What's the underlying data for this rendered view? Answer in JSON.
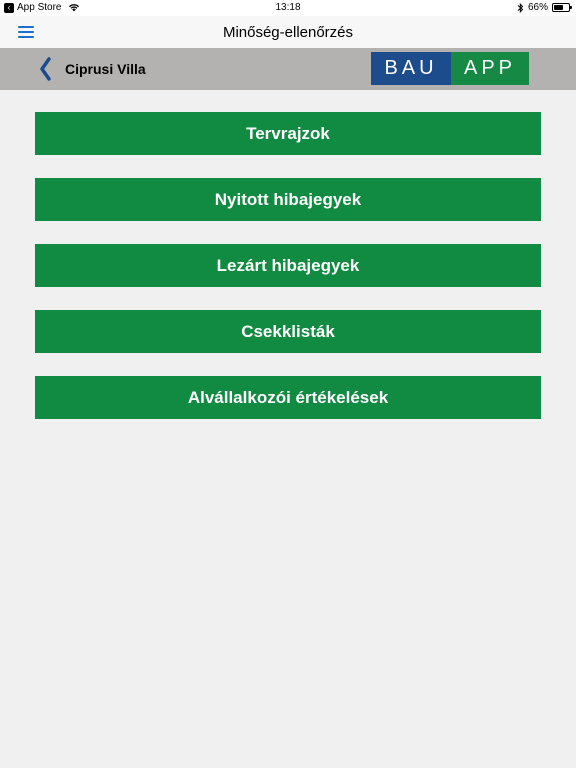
{
  "status_bar": {
    "back_app": "App Store",
    "time": "13:18",
    "battery": "66%",
    "battery_level": 0.66
  },
  "nav": {
    "title": "Minőség-ellenőrzés"
  },
  "project": {
    "title": "Ciprusi Villa"
  },
  "logo": {
    "part1": "BAU",
    "part2": "APP"
  },
  "colors": {
    "button_green": "#118a42",
    "logo_blue": "#1c4c8c",
    "logo_green": "#168a44",
    "accent_blue": "#1a6fd1",
    "project_bar": "#b4b1b1"
  },
  "menu": {
    "items": [
      {
        "label": "Tervrajzok"
      },
      {
        "label": "Nyitott hibajegyek"
      },
      {
        "label": "Lezárt hibajegyek"
      },
      {
        "label": "Csekklisták"
      },
      {
        "label": "Alvállalkozói értékelések"
      }
    ]
  }
}
